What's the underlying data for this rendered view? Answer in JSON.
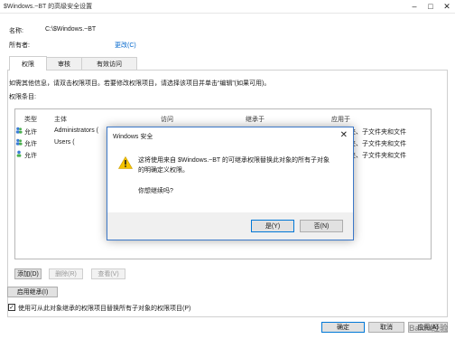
{
  "window": {
    "title": "$Windows.~BT 的高级安全设置",
    "name_label": "名称:",
    "name_value": "C:\\$Windows.~BT",
    "owner_label": "所有者:",
    "owner_change_link": "更改(C)"
  },
  "tabs": [
    {
      "label": "权限"
    },
    {
      "label": "审核"
    },
    {
      "label": "有效访问"
    }
  ],
  "permissions": {
    "info_text": "如需其他信息，请双击权限项目。若要修改权限项目，请选择该项目并单击“编辑”(如果可用)。",
    "entries_label": "权限条目:",
    "columns": {
      "type": "类型",
      "principal": "主体",
      "access": "访问",
      "inherited_from": "继承于",
      "applies_to": "应用于"
    },
    "rows": [
      {
        "type": "允许",
        "principal": "Administrators (",
        "applies_to": "夹、子文件夹和文件"
      },
      {
        "type": "允许",
        "principal": "Users (",
        "applies_to": "夹、子文件夹和文件"
      },
      {
        "type": "允许",
        "principal": "",
        "applies_to": "夹、子文件夹和文件"
      }
    ]
  },
  "buttons": {
    "add": "添加(D)",
    "remove": "删除(R)",
    "view": "查看(V)",
    "enable_inheritance": "启用继承(I)",
    "replace_checkbox": "使用可从此对象继承的权限项目替换所有子对象的权限项目(P)",
    "ok": "确定",
    "cancel": "取消",
    "apply": "应用(A)"
  },
  "dialog": {
    "title": "Windows 安全",
    "message_line1": "这将使用来自 $Windows.~BT 的可继承权限替换此对象的所有子对象",
    "message_line2": "的明确定义权限。",
    "question": "你想继续吗?",
    "yes": "是(Y)",
    "no": "否(N)",
    "icon": "warning-icon"
  },
  "watermark": "Baidu经验"
}
